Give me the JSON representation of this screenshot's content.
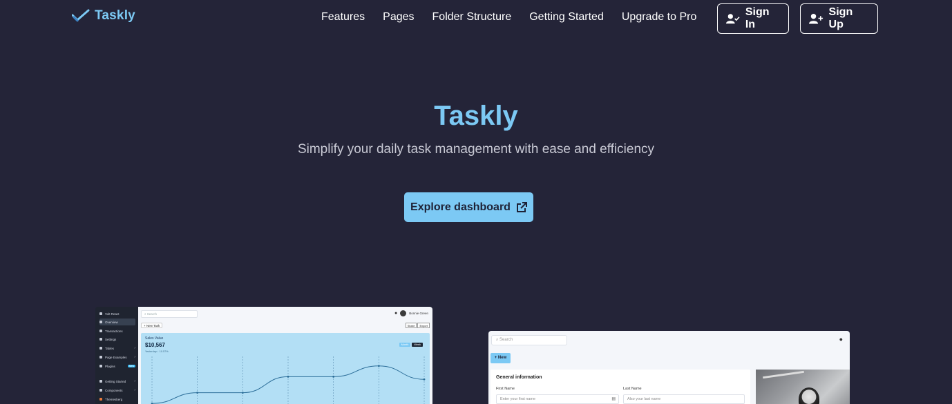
{
  "nav": {
    "brand": "Taskly",
    "links": [
      "Features",
      "Pages",
      "Folder Structure",
      "Getting Started",
      "Upgrade to Pro"
    ],
    "sign_in": "Sign In",
    "sign_up": "Sign Up"
  },
  "hero": {
    "title": "Taskly",
    "subtitle": "Simplify your daily task management with ease and efficiency",
    "cta": "Explore dashboard"
  },
  "preview_dashboard": {
    "sidebar": [
      {
        "label": "Volt React",
        "active": false
      },
      {
        "label": "Overview",
        "active": true
      },
      {
        "label": "Transactions",
        "active": false
      },
      {
        "label": "Settings",
        "active": false
      },
      {
        "label": "Tables",
        "active": false,
        "arrow": "›"
      },
      {
        "label": "Page Examples",
        "active": false,
        "arrow": "›"
      },
      {
        "label": "Plugins",
        "active": false,
        "badge": "New"
      },
      {
        "label": "Getting Started",
        "active": false,
        "arrow": "›"
      },
      {
        "label": "Components",
        "active": false,
        "arrow": "›"
      },
      {
        "label": "Themesberg",
        "active": false
      }
    ],
    "search_placeholder": "Search",
    "user_name": "Bonnie Green",
    "new_task": "+ New Task",
    "share": "Share",
    "export": "Export",
    "card_label": "Sales Value",
    "card_value": "$10,567",
    "card_delta": "Yesterday ↑ 10.57%",
    "toggle_month": "Month",
    "toggle_week": "Week",
    "chart_values": [
      2,
      6,
      6,
      12,
      12,
      16,
      11
    ]
  },
  "preview_form": {
    "search_placeholder": "Search",
    "new_button": "+ New",
    "form_title": "General information",
    "first_name_label": "First Name",
    "first_name_placeholder": "Enter your first name",
    "last_name_label": "Last Name",
    "last_name_placeholder": "Also your last name"
  },
  "colors": {
    "background": "#242438",
    "accent": "#7cc9f4"
  }
}
